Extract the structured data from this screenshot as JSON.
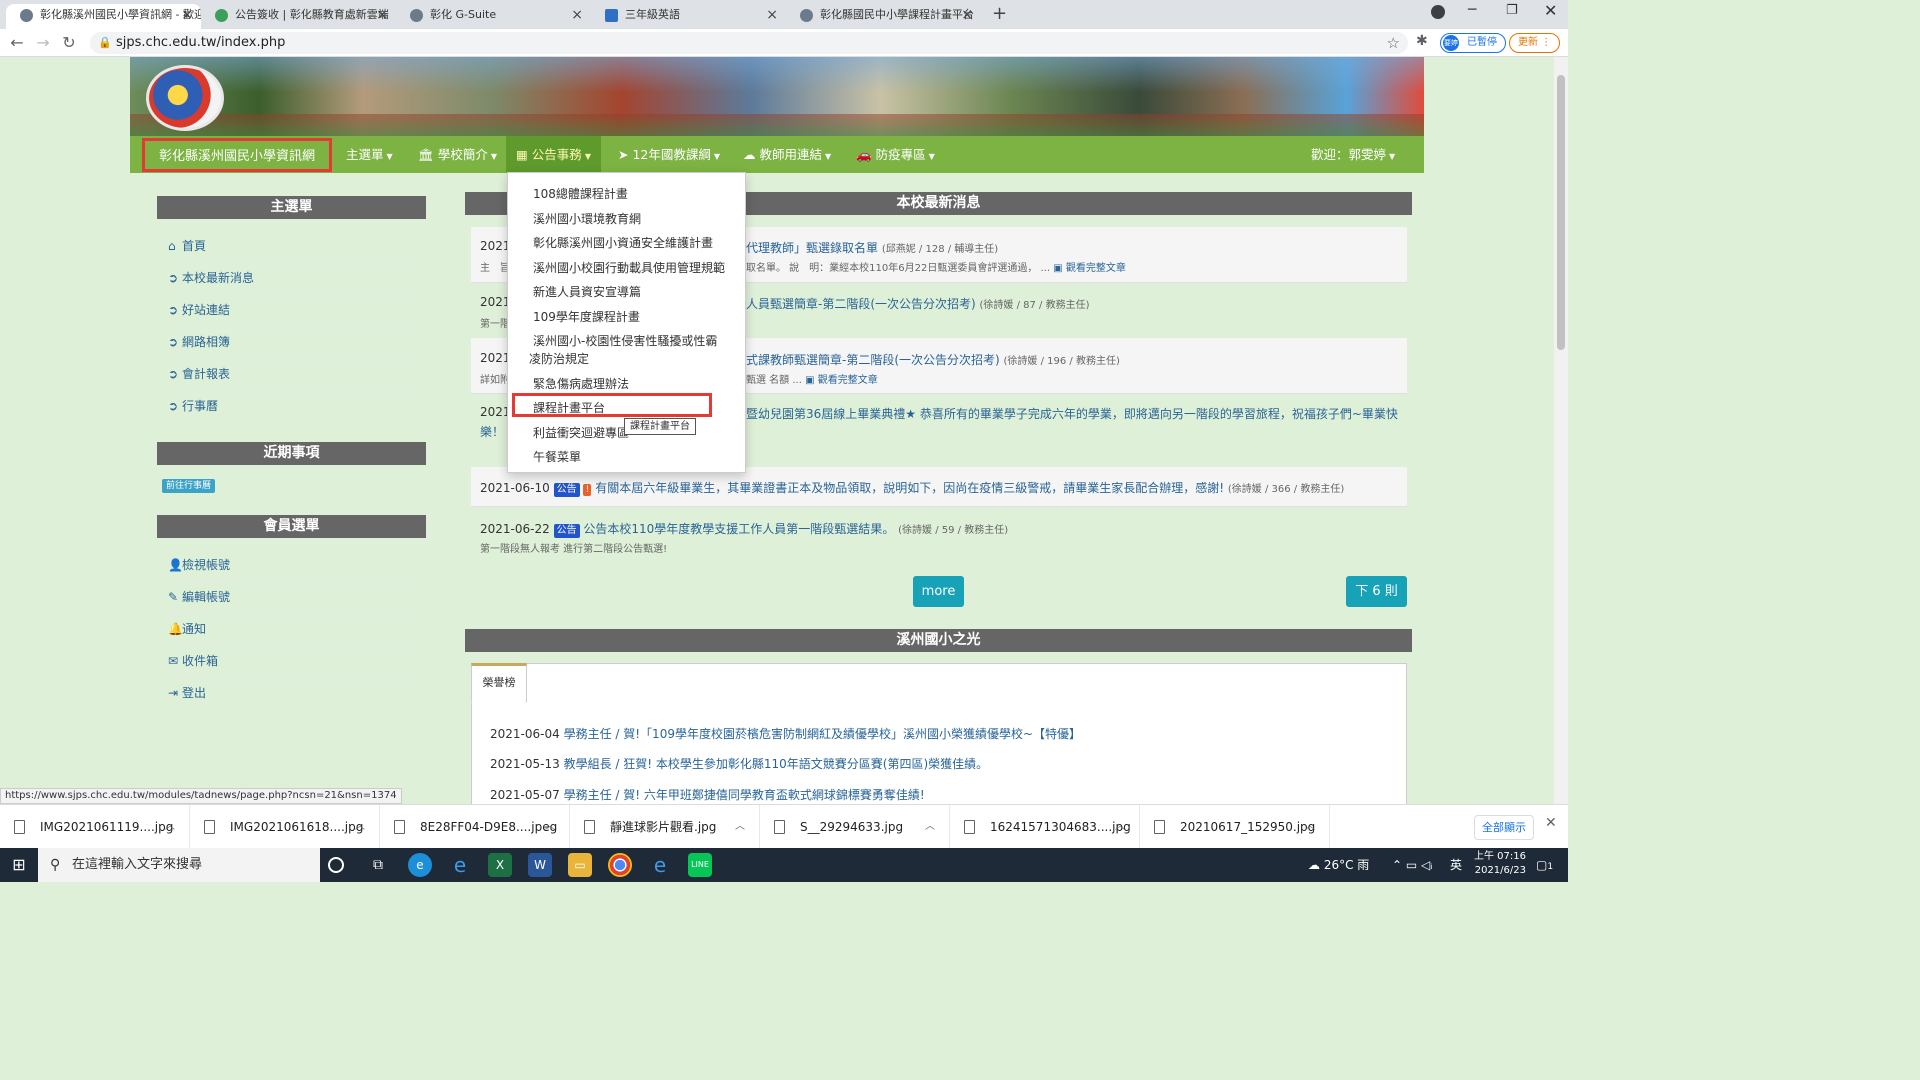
{
  "browser": {
    "tabs": [
      {
        "title": "彰化縣溪州國民小學資訊網 - 歡迎"
      },
      {
        "title": "公告簽收 | 彰化縣教育處新雲端"
      },
      {
        "title": "彰化 G-Suite"
      },
      {
        "title": "三年級英語"
      },
      {
        "title": "彰化縣國民中小學課程計畫平台"
      }
    ],
    "new_tab": "+",
    "url": "sjps.chc.edu.tw/index.php",
    "profile": "已暫停",
    "profile_avatar": "要婷",
    "update": "更新"
  },
  "site": {
    "title": "彰化縣溪州國民小學資訊網",
    "nav": [
      {
        "label": "主選單",
        "icon": ""
      },
      {
        "label": "學校簡介",
        "icon": "🏛"
      },
      {
        "label": "公告事務",
        "icon": "▦"
      },
      {
        "label": "12年國教課綱",
        "icon": "➤"
      },
      {
        "label": "教師用連結",
        "icon": "☁"
      },
      {
        "label": "防疫專區",
        "icon": "🚗"
      }
    ],
    "welcome": "歡迎：郭雯婷"
  },
  "dropdown": {
    "items": [
      "108總體課程計畫",
      "溪州國小環境教育網",
      "彰化縣溪州國小資通安全維護計畫",
      "溪州國小校園行動載具使用管理規範",
      "新進人員資安宣導篇",
      "109學年度課程計畫",
      "溪州國小-校園性侵害性騷擾或性霸",
      "凌防治規定",
      "緊急傷病處理辦法",
      "課程計畫平台",
      "利益衝突迴避專區",
      "午餐菜單"
    ],
    "tooltip": "課程計畫平台"
  },
  "sidebar": {
    "main_menu_title": "主選單",
    "main_menu": [
      {
        "label": "首頁",
        "icon": "home-icon"
      },
      {
        "label": "本校最新消息",
        "icon": "arrow-circle-icon"
      },
      {
        "label": "好站連結",
        "icon": "arrow-circle-icon"
      },
      {
        "label": "網路相簿",
        "icon": "arrow-circle-icon"
      },
      {
        "label": "會計報表",
        "icon": "arrow-circle-icon"
      },
      {
        "label": "行事曆",
        "icon": "arrow-circle-icon"
      }
    ],
    "recent_title": "近期事項",
    "calendar_badge": "前往行事曆",
    "member_title": "會員選單",
    "member_menu": [
      {
        "label": "檢視帳號",
        "icon": "user-icon"
      },
      {
        "label": "編輯帳號",
        "icon": "pencil-icon"
      },
      {
        "label": "通知",
        "icon": "bell-icon"
      },
      {
        "label": "收件箱",
        "icon": "envelope-icon"
      },
      {
        "label": "登出",
        "icon": "sign-out-icon"
      }
    ]
  },
  "news": {
    "title": "本校最新消息",
    "items": [
      {
        "date": "2021-",
        "title": "代理教師」甄選錄取名單",
        "meta": "(邱燕妮 / 128 / 輔導主任)",
        "sub": "主　旨：",
        "sub2": "取名單。 說　明：業經本校110年6月22日甄選委員會評選通過， ...",
        "more": "觀看完整文章"
      },
      {
        "date": "2021-",
        "title": "人員甄選簡章-第二階段(一次公告分次招考)",
        "meta": "(徐詩媛 / 87 / 教務主任)",
        "sub": "第一階"
      },
      {
        "date": "2021-",
        "title": "式課教師甄選簡章-第二階段(一次公告分次招考)",
        "meta": "(徐詩媛 / 196 / 教務主任)",
        "sub": "詳如附",
        "sub2": "甄選 名額 ...",
        "more": "觀看完整文章"
      },
      {
        "date": "2021",
        "title": "暨幼兒園第36屆線上畢業典禮★ 恭喜所有的畢業學子完成六年的學業，即將邁向另一階段的學習旅程，祝福孩子們~畢業快",
        "title2": "樂！"
      },
      {
        "date": "2021-06-10",
        "tag": "公告",
        "warn": "!",
        "title": "有關本屆六年級畢業生，其畢業證書正本及物品領取，說明如下，因尚在疫情三級警戒，請畢業生家長配合辦理，感謝!",
        "meta": "(徐詩媛 / 366 / 教務主任)"
      },
      {
        "date": "2021-06-22",
        "tag": "公告",
        "title": "公告本校110學年度教學支援工作人員第一階段甄選結果。",
        "meta": "(徐詩媛 / 59 / 教務主任)",
        "sub": "第一階段無人報考 進行第二階段公告甄選!"
      }
    ],
    "more_button": "more",
    "next_button": "下 6 則"
  },
  "honor": {
    "title": "溪州國小之光",
    "tab": "榮譽榜",
    "items": [
      {
        "date": "2021-06-04",
        "who": "學務主任 / 賀!「109學年度校園菸檳危害防制網紅及績優學校」溪州國小榮獲績優學校~【特優】"
      },
      {
        "date": "2021-05-13",
        "who": "教學組長 / 狂賀! 本校學生參加彰化縣110年語文競賽分區賽(第四區)榮獲佳績。"
      },
      {
        "date": "2021-05-07",
        "who": "學務主任 / 賀! 六年甲班鄭捷僖同學教育盃軟式網球錦標賽勇奪佳績!"
      }
    ]
  },
  "status_url": "https://www.sjps.chc.edu.tw/modules/tadnews/page.php?ncsn=21&nsn=1374",
  "downloads": {
    "items": [
      "IMG2021061119....jpg",
      "IMG2021061618....jpg",
      "8E28FF04-D9E8....jpeg",
      "靜進球影片觀看.jpg",
      "S__29294633.jpg",
      "16241571304683....jpg",
      "20210617_152950.jpg"
    ],
    "show_all": "全部顯示"
  },
  "taskbar": {
    "search_placeholder": "在這裡輸入文字來搜尋",
    "weather": "26°C 雨",
    "ime": "英",
    "time": "上午 07:16",
    "date": "2021/6/23",
    "notif": "1"
  },
  "colors": {
    "nav_green": "#7cb342",
    "highlight_red": "#e53935",
    "link_blue": "#2a6496",
    "button_teal": "#17a2b8"
  }
}
